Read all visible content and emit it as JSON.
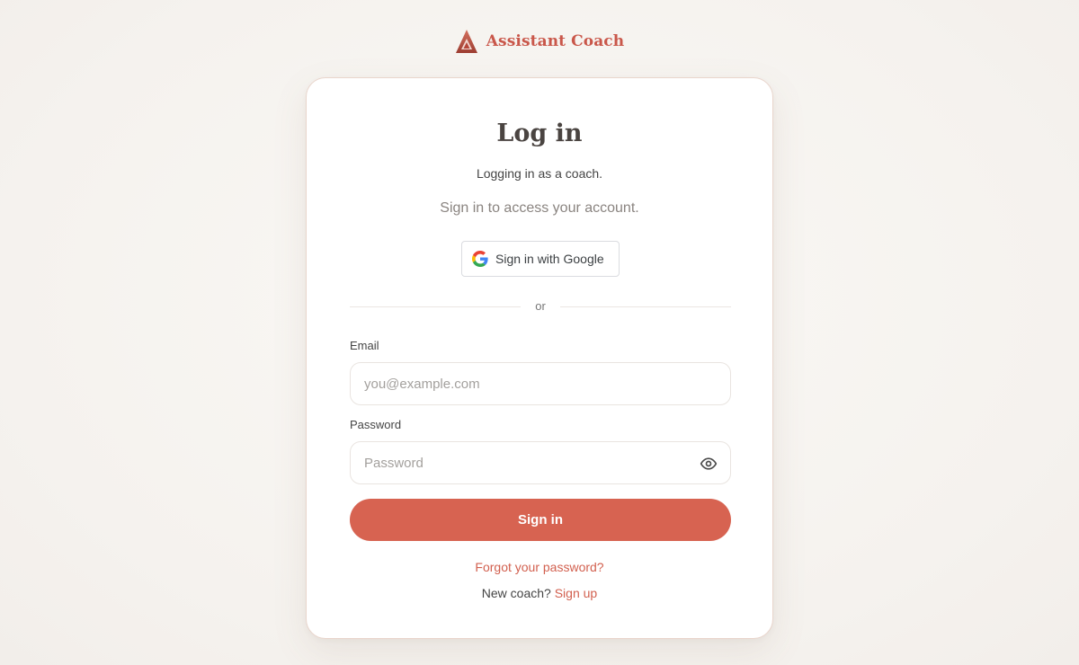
{
  "brand": {
    "name": "Assistant Coach",
    "logo_icon": "triangle-logo-icon",
    "color": "#c9574a"
  },
  "login": {
    "title": "Log in",
    "subtitle": "Logging in as a coach.",
    "hint": "Sign in to access your account.",
    "google_button_label": "Sign in with Google",
    "divider_text": "or",
    "email_label": "Email",
    "email_placeholder": "you@example.com",
    "email_value": "",
    "password_label": "Password",
    "password_placeholder": "Password",
    "password_value": "",
    "password_toggle_icon": "eye-icon",
    "submit_label": "Sign in",
    "forgot_link": "Forgot your password?",
    "signup_prompt": "New coach?",
    "signup_link": "Sign up"
  },
  "colors": {
    "accent": "#d76351",
    "link": "#d2604f",
    "background": "#f7f4f0",
    "card_border": "#e9d5cc"
  }
}
